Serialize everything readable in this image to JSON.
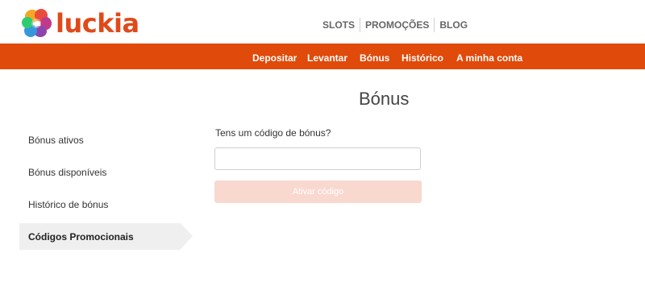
{
  "brand": {
    "name": "luckia",
    "color": "#e04a1a"
  },
  "top_nav": {
    "items": [
      {
        "label": "SLOTS"
      },
      {
        "label": "PROMOÇÕES"
      },
      {
        "label": "BLOG"
      }
    ]
  },
  "main_nav": {
    "background": "#e04a0a",
    "items": [
      {
        "label": "Depositar"
      },
      {
        "label": "Levantar"
      },
      {
        "label": "Bónus"
      },
      {
        "label": "Histórico"
      },
      {
        "label": "A minha conta"
      }
    ]
  },
  "page": {
    "title": "Bónus"
  },
  "sidebar": {
    "items": [
      {
        "label": "Bónus ativos"
      },
      {
        "label": "Bónus disponíveis"
      },
      {
        "label": "Histórico de bónus"
      },
      {
        "label": "Códigos Promocionais",
        "active": true
      }
    ]
  },
  "form": {
    "question": "Tens um código de bónus?",
    "input_value": "",
    "button_label": "Ativar código",
    "button_color": "#f9d8cf"
  }
}
